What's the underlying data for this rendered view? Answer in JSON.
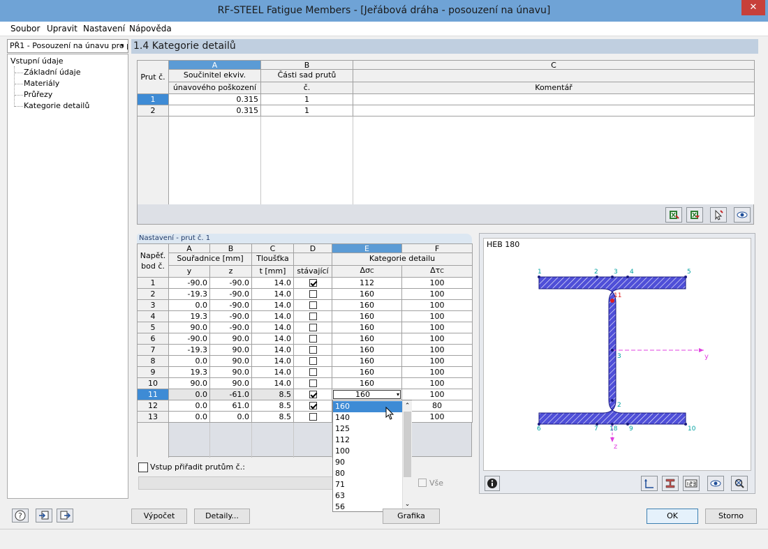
{
  "window": {
    "title": "RF-STEEL Fatigue Members - [Jeřábová dráha - posouzení na únavu]",
    "close_glyph": "✕",
    "minimize_glyph": "—",
    "maximize_glyph": "☐"
  },
  "menu": [
    "Soubor",
    "Upravit",
    "Nastavení",
    "Nápověda"
  ],
  "nav": {
    "select_value": "PŘ1 - Posouzení na únavu pro p",
    "dropdown_glyph": "▾",
    "tree_root": "Vstupní údaje",
    "tree_items": [
      "Základní údaje",
      "Materiály",
      "Průřezy",
      "Kategorie detailů"
    ]
  },
  "section_title": "1.4 Kategorie detailů",
  "top_grid": {
    "col_letters": [
      "A",
      "B",
      "C"
    ],
    "row_header_label": "Prut č.",
    "col_headers": [
      [
        "Součinitel ekviv.",
        "únavového poškození"
      ],
      [
        "Části sad prutů",
        "č."
      ],
      [
        "",
        "Komentář"
      ]
    ],
    "rows": [
      {
        "n": "1",
        "a": "0.315",
        "b": "1",
        "c": ""
      },
      {
        "n": "2",
        "a": "0.315",
        "b": "1",
        "c": ""
      }
    ]
  },
  "settings": {
    "title": "Nastavení - prut č. 1",
    "row_header_label": [
      "Napěť.",
      "bod č."
    ],
    "col_letters": [
      "A",
      "B",
      "C",
      "D",
      "E",
      "F"
    ],
    "group_headers": {
      "souradnice": "Souřadnice [mm]",
      "tloustka": "Tloušťka",
      "kategorie": "Kategorie detailu"
    },
    "sub_headers": {
      "y": "y",
      "z": "z",
      "t": "t [mm]",
      "stavajici": "stávající",
      "ds": "Δσ",
      "ds_sub": "C",
      "dt": "Δτ",
      "dt_sub": "C"
    },
    "rows": [
      {
        "n": "1",
        "y": "-90.0",
        "z": "-90.0",
        "t": "14.0",
        "chk": true,
        "e": "112",
        "f": "100"
      },
      {
        "n": "2",
        "y": "-19.3",
        "z": "-90.0",
        "t": "14.0",
        "chk": false,
        "e": "160",
        "f": "100"
      },
      {
        "n": "3",
        "y": "0.0",
        "z": "-90.0",
        "t": "14.0",
        "chk": false,
        "e": "160",
        "f": "100"
      },
      {
        "n": "4",
        "y": "19.3",
        "z": "-90.0",
        "t": "14.0",
        "chk": false,
        "e": "160",
        "f": "100"
      },
      {
        "n": "5",
        "y": "90.0",
        "z": "-90.0",
        "t": "14.0",
        "chk": false,
        "e": "160",
        "f": "100"
      },
      {
        "n": "6",
        "y": "-90.0",
        "z": "90.0",
        "t": "14.0",
        "chk": false,
        "e": "160",
        "f": "100"
      },
      {
        "n": "7",
        "y": "-19.3",
        "z": "90.0",
        "t": "14.0",
        "chk": false,
        "e": "160",
        "f": "100"
      },
      {
        "n": "8",
        "y": "0.0",
        "z": "90.0",
        "t": "14.0",
        "chk": false,
        "e": "160",
        "f": "100"
      },
      {
        "n": "9",
        "y": "19.3",
        "z": "90.0",
        "t": "14.0",
        "chk": false,
        "e": "160",
        "f": "100"
      },
      {
        "n": "10",
        "y": "90.0",
        "z": "90.0",
        "t": "14.0",
        "chk": false,
        "e": "160",
        "f": "100"
      },
      {
        "n": "11",
        "y": "0.0",
        "z": "-61.0",
        "t": "8.5",
        "chk": true,
        "e": "160",
        "f": "100"
      },
      {
        "n": "12",
        "y": "0.0",
        "z": "61.0",
        "t": "8.5",
        "chk": true,
        "e": "160",
        "f": "80"
      },
      {
        "n": "13",
        "y": "0.0",
        "z": "0.0",
        "t": "8.5",
        "chk": false,
        "e": "160",
        "f": "100"
      }
    ],
    "assign_label": "Vstup přiřadit prutům č.:",
    "all_label": "Vše"
  },
  "dropdown": {
    "options": [
      "160",
      "140",
      "125",
      "112",
      "100",
      "90",
      "80",
      "71",
      "63",
      "56"
    ],
    "selected": "160",
    "scroll_up": "⌃",
    "scroll_down": "⌄"
  },
  "graphic": {
    "section": "HEB 180",
    "point_labels": [
      "1",
      "2",
      "3",
      "4",
      "5",
      "6",
      "7",
      "8",
      "9",
      "10",
      "11",
      "3",
      "2",
      "18"
    ],
    "axis_y": "y",
    "axis_z": "z"
  },
  "buttons": {
    "vypocet": "Výpočet",
    "detaily": "Detaily...",
    "grafika": "Grafika",
    "ok": "OK",
    "storno": "Storno"
  }
}
